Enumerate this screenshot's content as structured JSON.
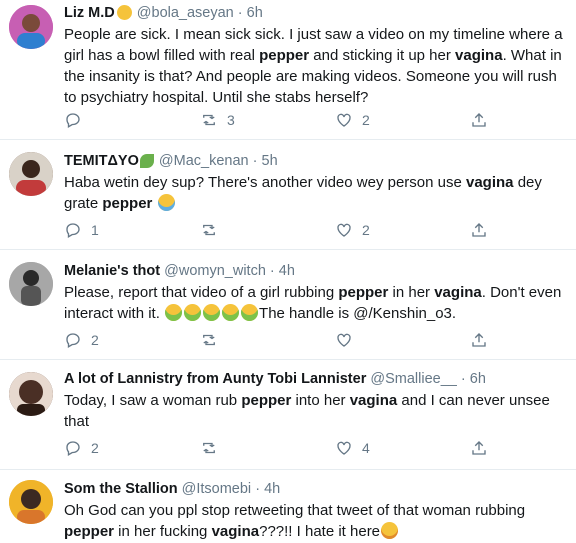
{
  "tweets": [
    {
      "name": "Liz M.D",
      "handle": "@bola_aseyan",
      "sep": "·",
      "time": "6h",
      "text_parts": [
        "People are sick. I mean sick sick. I just saw a video on my timeline where a girl has a bowl filled with real ",
        "pepper",
        " and sticking it up her ",
        "vagina",
        ". What in the insanity is that? And people are making videos. Someone you will rush to psychiatry hospital. Until she stabs herself?"
      ],
      "replies": "",
      "retweets": "3",
      "likes": "2",
      "avatar_color": "#b44aa0"
    },
    {
      "name": "TEMITΔYO",
      "handle": "@Mac_kenan",
      "sep": "·",
      "time": "5h",
      "text_parts": [
        "Haba wetin dey sup? There's another video wey person use ",
        "vagina",
        " dey grate ",
        "pepper",
        " "
      ],
      "replies": "1",
      "retweets": "",
      "likes": "2",
      "avatar_color": "#6b4a3a"
    },
    {
      "name": "Melanie's thot",
      "handle": "@womyn_witch",
      "sep": "·",
      "time": "4h",
      "text_parts": [
        "Please, report that video of a girl rubbing ",
        "pepper",
        " in her ",
        "vagina",
        ". Don't even interact with it. ",
        "The handle is @/Kenshin_o3."
      ],
      "replies": "2",
      "retweets": "",
      "likes": "",
      "avatar_color": "#8a8a8a"
    },
    {
      "name": "A lot of Lannistry from Aunty Tobi Lannister",
      "handle": "@Smalliee__",
      "sep": "·",
      "time": "6h",
      "text_parts": [
        "Today, I saw a woman rub ",
        "pepper",
        " into her ",
        "vagina",
        " and I can never unsee that"
      ],
      "replies": "2",
      "retweets": "",
      "likes": "4",
      "avatar_color": "#4a2f25"
    },
    {
      "name": "Som the Stallion",
      "handle": "@Itsomebi",
      "sep": "·",
      "time": "4h",
      "text_parts": [
        "Oh God can you ppl stop retweeting that tweet of that woman rubbing ",
        "pepper",
        " in her fucking ",
        "vagina",
        "???!! I hate it here"
      ],
      "replies": "",
      "retweets": "",
      "likes": "",
      "avatar_color": "#e0a020"
    }
  ],
  "icons": {
    "reply": "reply-icon",
    "retweet": "retweet-icon",
    "like": "heart-icon",
    "share": "share-icon"
  },
  "colors": {
    "text": "#14171a",
    "muted": "#657786",
    "divider": "#e6ecf0"
  }
}
